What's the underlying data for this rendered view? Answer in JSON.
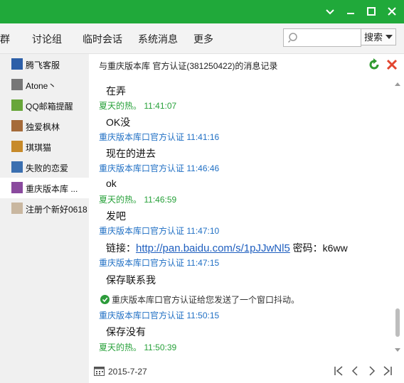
{
  "menu": [
    "讨论组",
    "临时会话",
    "系统消息",
    "更多"
  ],
  "menu_partial": "群",
  "search": {
    "placeholder": "",
    "button": "搜索"
  },
  "contacts": [
    {
      "name": "腾飞客服",
      "color": "#2d5fa8"
    },
    {
      "name": "Atone丶",
      "color": "#777777"
    },
    {
      "name": "QQ邮箱提醒",
      "color": "#68a63a"
    },
    {
      "name": "独爱枫林",
      "color": "#a56b3a"
    },
    {
      "name": "琪琪猫",
      "color": "#c78a2a"
    },
    {
      "name": "失败的恋爱",
      "color": "#3b6fb0"
    },
    {
      "name": "重庆版本库 ...",
      "color": "#8a4a9e"
    },
    {
      "name": "注册个新好0618",
      "color": "#c9b7a0"
    }
  ],
  "active_contact": 6,
  "header": {
    "title": "与重庆版本库  官方认证(381250422)的消息记录"
  },
  "messages": [
    {
      "type": "text",
      "text": "在弄"
    },
    {
      "type": "meta",
      "sender": "夏天的热。",
      "time": "11:41:07",
      "color": "#27a13a"
    },
    {
      "type": "text",
      "text": "OK没"
    },
    {
      "type": "meta",
      "sender": "重庆版本库口官方认证",
      "time": "11:41:16",
      "color": "#1f6fc4"
    },
    {
      "type": "text",
      "text": "现在的进去"
    },
    {
      "type": "meta",
      "sender": "重庆版本库口官方认证",
      "time": "11:46:46",
      "color": "#1f6fc4"
    },
    {
      "type": "text",
      "text": "ok"
    },
    {
      "type": "meta",
      "sender": "夏天的热。",
      "time": "11:46:59",
      "color": "#27a13a"
    },
    {
      "type": "text",
      "text": "发吧"
    },
    {
      "type": "meta",
      "sender": "重庆版本库口官方认证",
      "time": "11:47:10",
      "color": "#1f6fc4"
    },
    {
      "type": "link",
      "prefix": "链接：",
      "link": "http://pan.baidu.com/s/1pJJwNl5",
      "suffix": " 密码：k6ww"
    },
    {
      "type": "meta",
      "sender": "重庆版本库口官方认证",
      "time": "11:47:15",
      "color": "#1f6fc4"
    },
    {
      "type": "text",
      "text": "保存联系我"
    },
    {
      "type": "system",
      "text": "重庆版本库口官方认证给您发送了一个窗口抖动。"
    },
    {
      "type": "meta",
      "sender": "重庆版本库口官方认证",
      "time": "11:50:15",
      "color": "#1f6fc4"
    },
    {
      "type": "text",
      "text": "保存没有"
    },
    {
      "type": "meta",
      "sender": "夏天的热。",
      "time": "11:50:39",
      "color": "#27a13a"
    }
  ],
  "footer": {
    "date": "2015-7-27"
  },
  "colors": {
    "titlebar": "#20a93a",
    "green_sender": "#27a13a",
    "blue_sender": "#1f6fc4",
    "link": "#1f5fbf"
  },
  "icons": [
    "minimize-icon",
    "maximize-icon",
    "close-icon",
    "search-icon",
    "dropdown-icon",
    "refresh-icon",
    "delete-icon",
    "calendar-icon",
    "first-page-icon",
    "prev-page-icon",
    "next-page-icon",
    "last-page-icon"
  ]
}
